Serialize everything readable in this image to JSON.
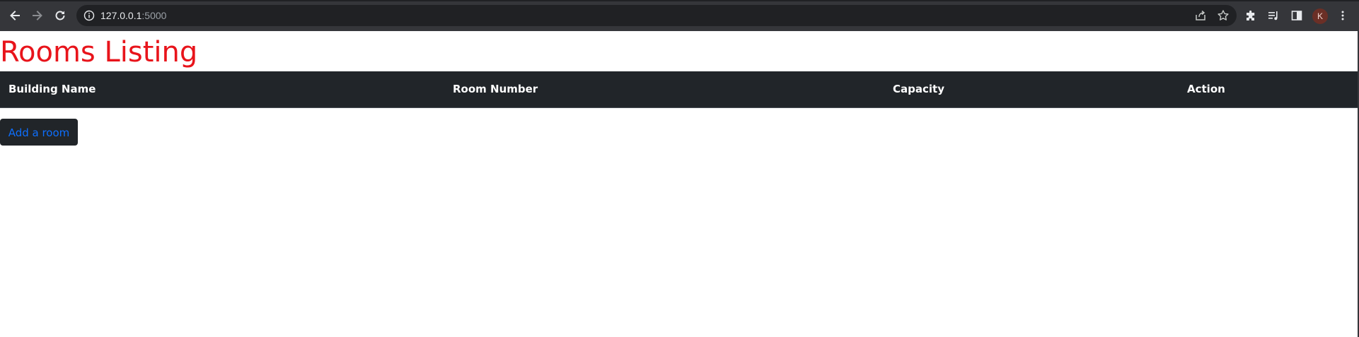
{
  "browser": {
    "url_host": "127.0.0.1",
    "url_port": ":5000",
    "profile_initial": "K",
    "icons": {
      "back": "arrow-left-icon",
      "forward": "arrow-right-icon",
      "reload": "reload-icon",
      "site_info": "info-icon",
      "share": "share-icon",
      "bookmark": "star-icon",
      "extensions": "puzzle-icon",
      "media": "media-queue-icon",
      "side_panel": "side-panel-icon",
      "menu": "kebab-menu-icon"
    }
  },
  "page": {
    "title": "Rooms Listing",
    "title_color": "#e8141b",
    "table": {
      "headers": [
        "Building Name",
        "Room Number",
        "Capacity",
        "Action"
      ],
      "rows": []
    },
    "add_room_label": "Add a room",
    "add_room_color": "#0d6efd",
    "header_bg": "#212529"
  }
}
